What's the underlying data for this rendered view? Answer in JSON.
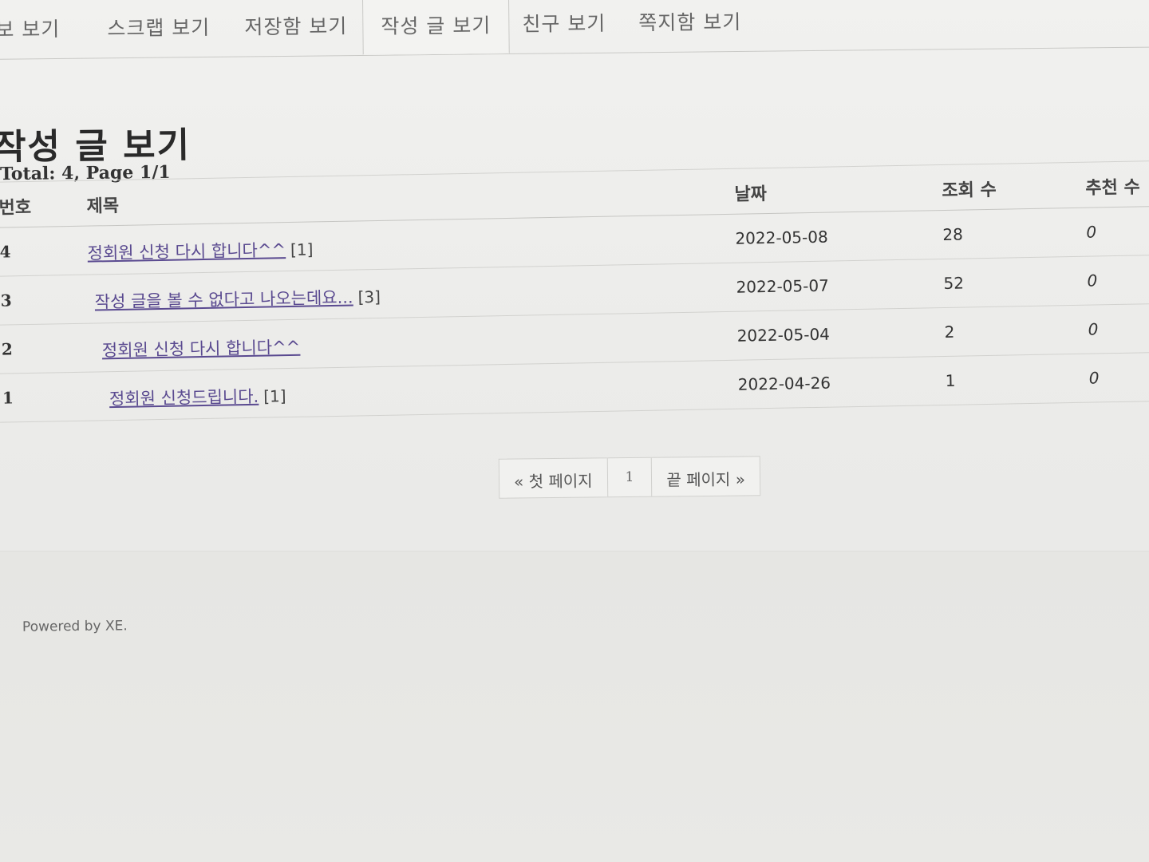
{
  "tabs": [
    {
      "label": "정보 보기"
    },
    {
      "label": "스크랩 보기"
    },
    {
      "label": "저장함 보기"
    },
    {
      "label": "작성 글 보기"
    },
    {
      "label": "친구 보기"
    },
    {
      "label": "쪽지함 보기"
    }
  ],
  "page": {
    "title": "작성 글 보기",
    "summary": "Total: 4, Page 1/1"
  },
  "table": {
    "headers": {
      "no": "번호",
      "title": "제목",
      "date": "날짜",
      "views": "조회 수",
      "recommend": "추천 수"
    },
    "rows": [
      {
        "no": "4",
        "title": "정회원 신청 다시 합니다^^",
        "comments": "[1]",
        "date": "2022-05-08",
        "views": "28",
        "recommend": "0"
      },
      {
        "no": "3",
        "title": "작성 글을 볼 수 없다고 나오는데요...",
        "comments": "[3]",
        "date": "2022-05-07",
        "views": "52",
        "recommend": "0"
      },
      {
        "no": "2",
        "title": "정회원 신청 다시 합니다^^",
        "comments": "",
        "date": "2022-05-04",
        "views": "2",
        "recommend": "0"
      },
      {
        "no": "1",
        "title": "정회원 신청드립니다.",
        "comments": "[1]",
        "date": "2022-04-26",
        "views": "1",
        "recommend": "0"
      }
    ]
  },
  "pagination": {
    "first": "« 첫 페이지",
    "current": "1",
    "last": "끝 페이지 »"
  },
  "footer": {
    "powered_by": "Powered by XE."
  }
}
